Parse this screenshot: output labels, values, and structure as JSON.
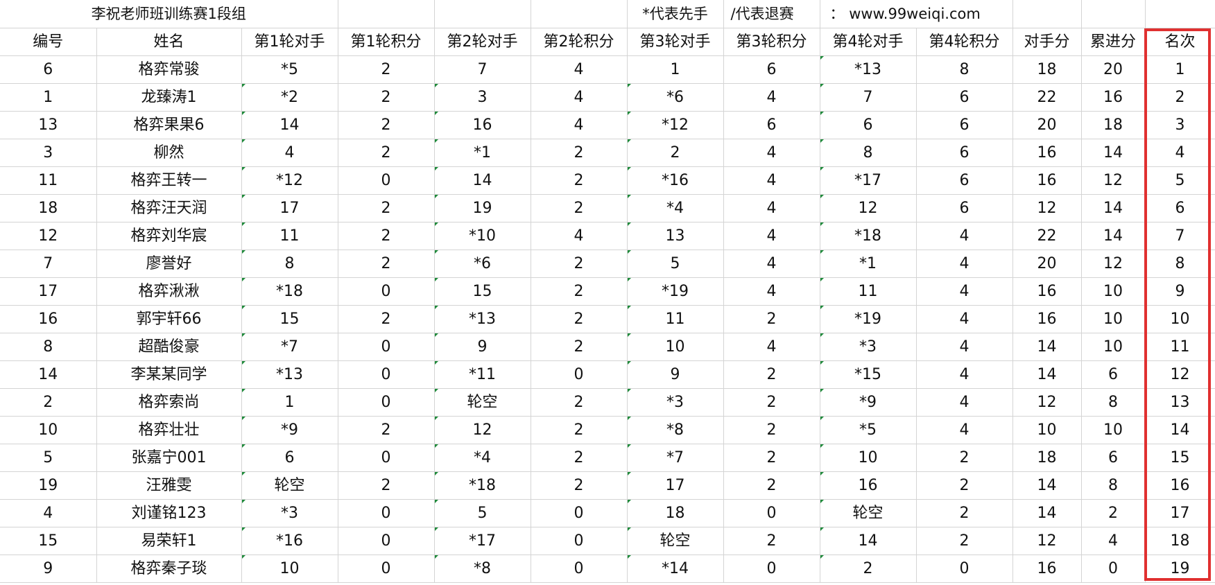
{
  "title": {
    "label": "李祝老师班训练赛1段组",
    "note_first": "*代表先手",
    "note_retire": "/代表退赛",
    "colon": "：",
    "url": "www.99weiqi.com"
  },
  "headers": [
    "编号",
    "姓名",
    "第1轮对手",
    "第1轮积分",
    "第2轮对手",
    "第2轮积分",
    "第3轮对手",
    "第3轮积分",
    "第4轮对手",
    "第4轮积分",
    "对手分",
    "累进分",
    "名次"
  ],
  "rows": [
    [
      "6",
      "格弈常骏",
      "*5",
      "2",
      "7",
      "4",
      "1",
      "6",
      "*13",
      "8",
      "18",
      "20",
      "1"
    ],
    [
      "1",
      "龙臻涛1",
      "*2",
      "2",
      "3",
      "4",
      "*6",
      "4",
      "7",
      "6",
      "22",
      "16",
      "2"
    ],
    [
      "13",
      "格弈果果6",
      "14",
      "2",
      "16",
      "4",
      "*12",
      "6",
      "6",
      "6",
      "20",
      "18",
      "3"
    ],
    [
      "3",
      "柳然",
      "4",
      "2",
      "*1",
      "2",
      "2",
      "4",
      "8",
      "6",
      "16",
      "14",
      "4"
    ],
    [
      "11",
      "格弈王转一",
      "*12",
      "0",
      "14",
      "2",
      "*16",
      "4",
      "*17",
      "6",
      "16",
      "12",
      "5"
    ],
    [
      "18",
      "格弈汪天润",
      "17",
      "2",
      "19",
      "2",
      "*4",
      "4",
      "12",
      "6",
      "12",
      "14",
      "6"
    ],
    [
      "12",
      "格弈刘华宸",
      "11",
      "2",
      "*10",
      "4",
      "13",
      "4",
      "*18",
      "4",
      "22",
      "14",
      "7"
    ],
    [
      "7",
      "廖誉好",
      "8",
      "2",
      "*6",
      "2",
      "5",
      "4",
      "*1",
      "4",
      "20",
      "12",
      "8"
    ],
    [
      "17",
      "格弈湫湫",
      "*18",
      "0",
      "15",
      "2",
      "*19",
      "4",
      "11",
      "4",
      "16",
      "10",
      "9"
    ],
    [
      "16",
      "郭宇轩66",
      "15",
      "2",
      "*13",
      "2",
      "11",
      "2",
      "*19",
      "4",
      "16",
      "10",
      "10"
    ],
    [
      "8",
      "超酷俊豪",
      "*7",
      "0",
      "9",
      "2",
      "10",
      "4",
      "*3",
      "4",
      "14",
      "10",
      "11"
    ],
    [
      "14",
      "李某某同学",
      "*13",
      "0",
      "*11",
      "0",
      "9",
      "2",
      "*15",
      "4",
      "14",
      "6",
      "12"
    ],
    [
      "2",
      "格弈索尚",
      "1",
      "0",
      "轮空",
      "2",
      "*3",
      "2",
      "*9",
      "4",
      "12",
      "8",
      "13"
    ],
    [
      "10",
      "格弈壮壮",
      "*9",
      "2",
      "12",
      "2",
      "*8",
      "2",
      "*5",
      "4",
      "10",
      "10",
      "14"
    ],
    [
      "5",
      "张嘉宁001",
      "6",
      "0",
      "*4",
      "2",
      "*7",
      "2",
      "10",
      "2",
      "18",
      "6",
      "15"
    ],
    [
      "19",
      "汪雅雯",
      "轮空",
      "2",
      "*18",
      "2",
      "17",
      "2",
      "16",
      "2",
      "14",
      "8",
      "16"
    ],
    [
      "4",
      "刘谨铭123",
      "*3",
      "0",
      "5",
      "0",
      "18",
      "0",
      "轮空",
      "2",
      "14",
      "2",
      "17"
    ],
    [
      "15",
      "易荣轩1",
      "*16",
      "0",
      "*17",
      "0",
      "轮空",
      "2",
      "14",
      "2",
      "12",
      "4",
      "18"
    ],
    [
      "9",
      "格弈秦子琰",
      "10",
      "0",
      "*8",
      "0",
      "*14",
      "0",
      "2",
      "0",
      "16",
      "0",
      "19"
    ]
  ],
  "highlight_color": "#e03030"
}
